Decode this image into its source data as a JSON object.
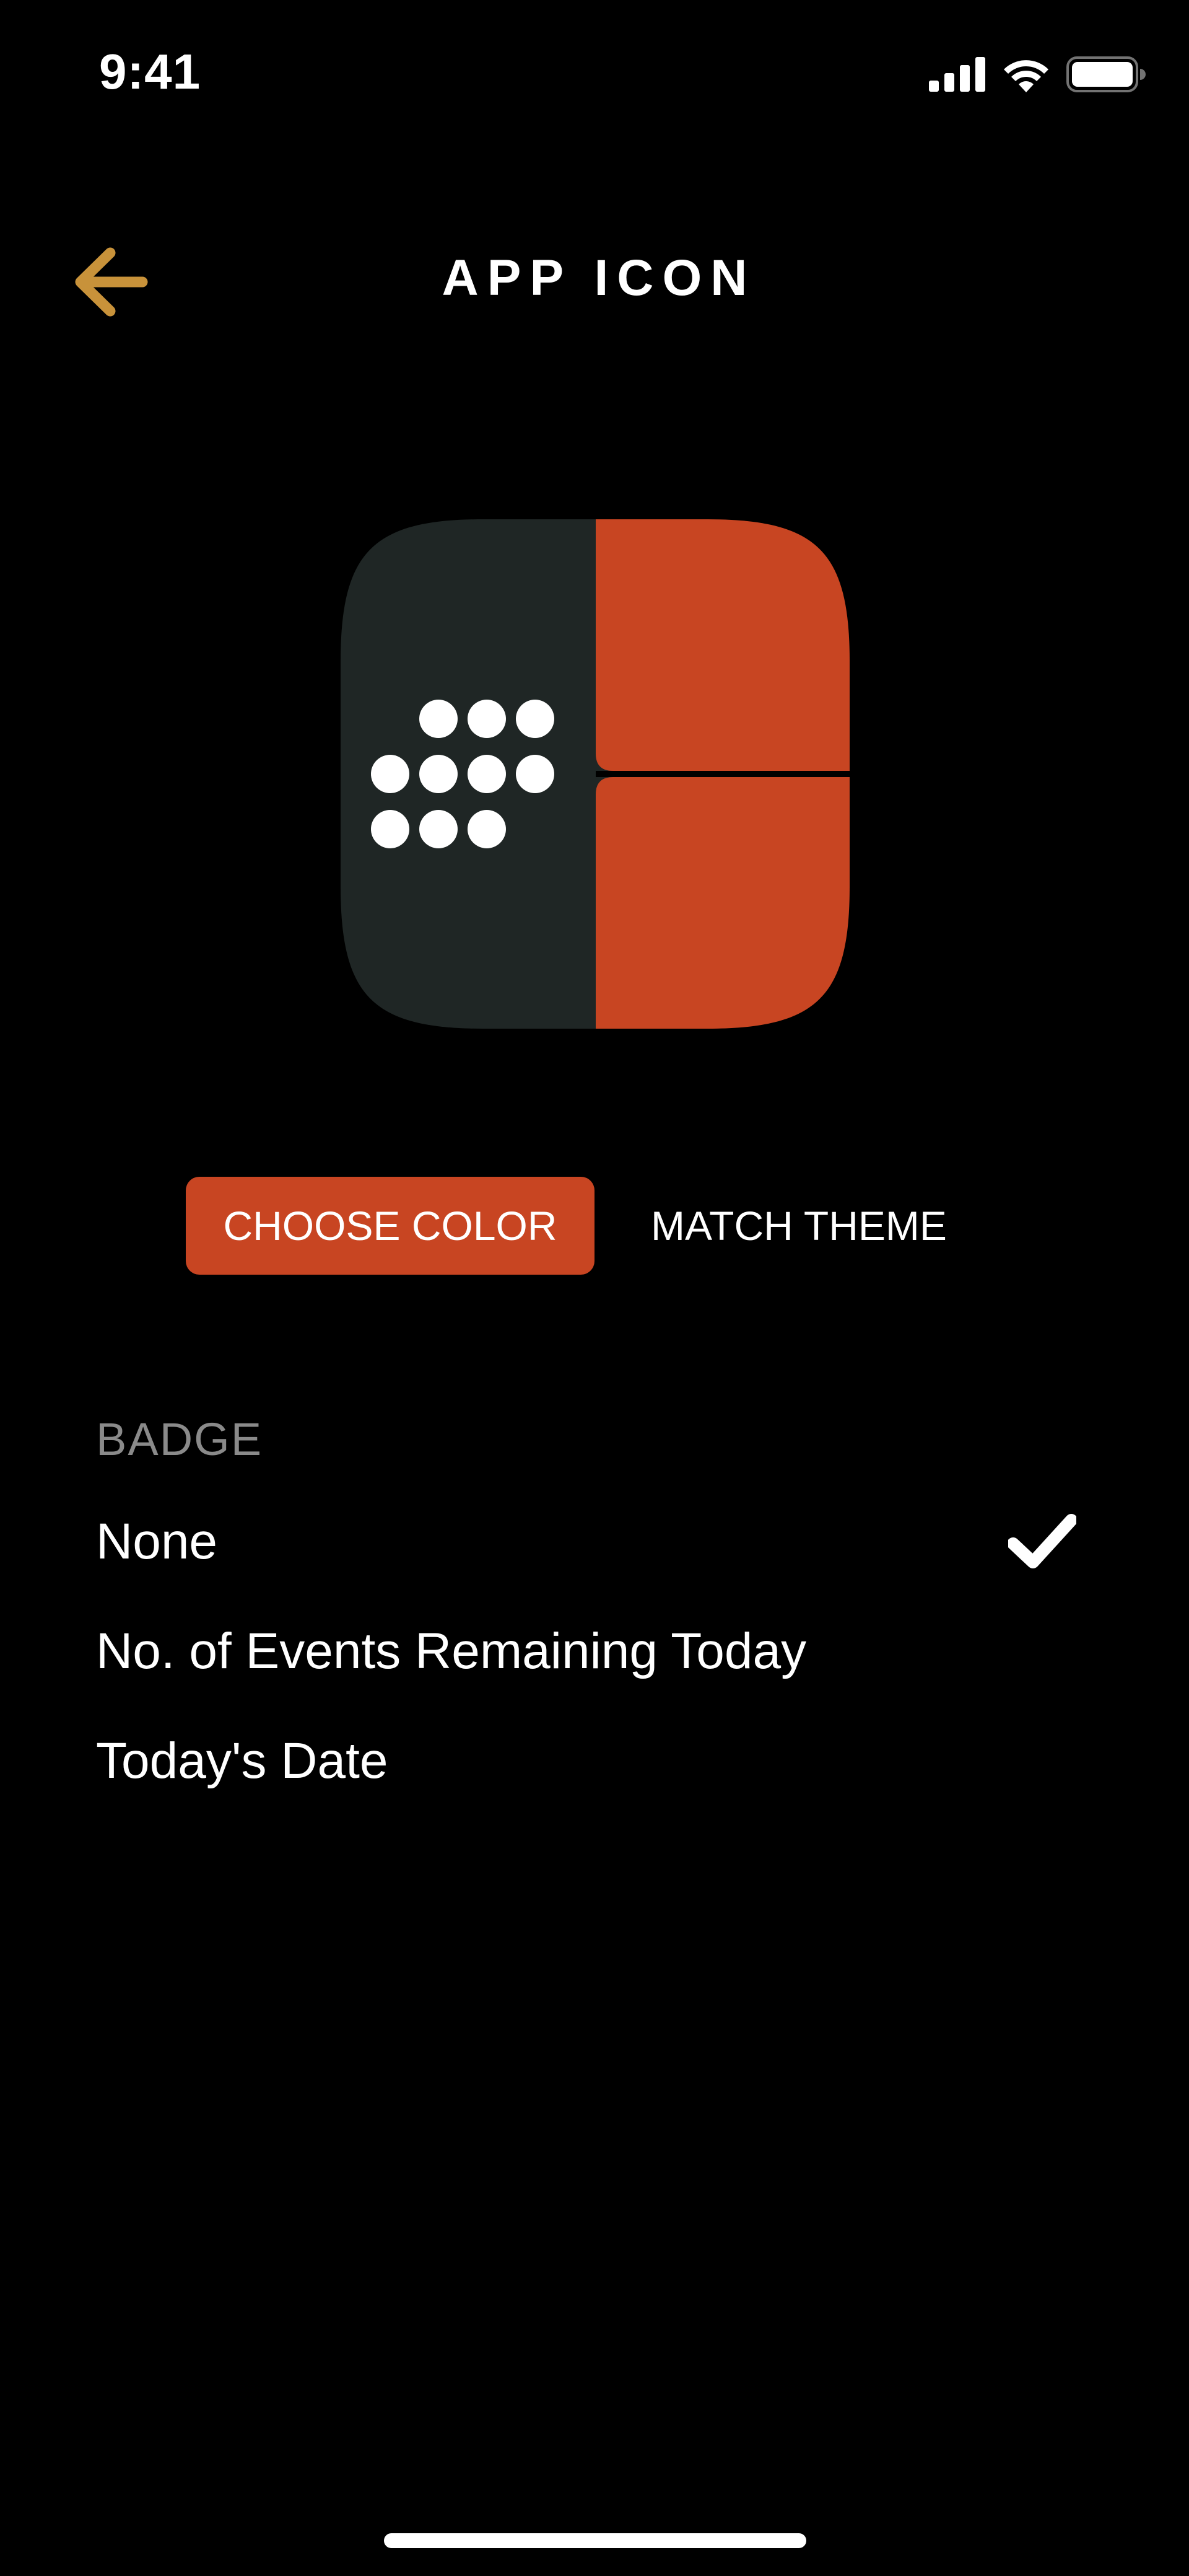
{
  "status_bar": {
    "time": "9:41"
  },
  "nav": {
    "title": "APP ICON",
    "back_icon": "arrow-left-icon"
  },
  "icon_preview": {
    "left_color": "#1f2625",
    "right_color": "#c84522",
    "dot_color": "#ffffff"
  },
  "mode_selector": {
    "choose_color_label": "CHOOSE COLOR",
    "match_theme_label": "MATCH THEME",
    "selected": "CHOOSE COLOR"
  },
  "badge": {
    "header": "BADGE",
    "options": [
      {
        "label": "None",
        "selected": true
      },
      {
        "label": "No. of Events Remaining Today",
        "selected": false
      },
      {
        "label": "Today's Date",
        "selected": false
      }
    ]
  },
  "colors": {
    "accent": "#c84522",
    "back_arrow": "#c8923a",
    "background": "#000000",
    "text": "#ffffff",
    "muted_text": "#8a8a8a"
  },
  "icons": {
    "selected_marker": "checkmark-icon"
  }
}
